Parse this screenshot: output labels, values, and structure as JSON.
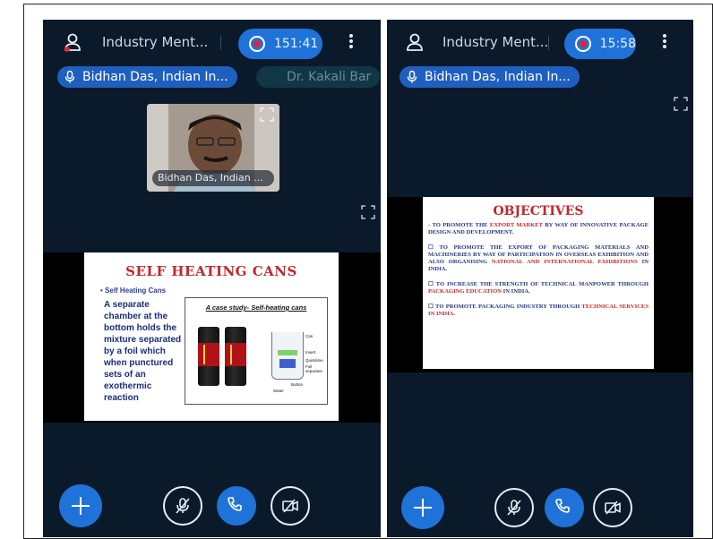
{
  "colors": {
    "panel_bg": "#0b1a2a",
    "accent_blue": "#1f73d8",
    "record_red": "#e0233a",
    "slide_title_red": "#c0282d",
    "slide_text_blue": "#1a2e78"
  },
  "left_phone": {
    "header": {
      "title": "Industry Ment...",
      "timer": "151:41"
    },
    "chips": [
      {
        "label": "Bidhan Das, Indian In..."
      },
      {
        "label": "Dr. Kakali Bar"
      }
    ],
    "video": {
      "name": "Bidhan Das, Indian ..."
    },
    "slide": {
      "title": "SELF HEATING CANS",
      "bullet": "Self Heating Cans",
      "text": "A separate chamber at the bottom holds the mixture separated by a foil which when punctured sets of an exothermic reaction",
      "figure_title": "A case study- Self-heating cans",
      "figure_labels": [
        "Can",
        "Insert",
        "Quicklime",
        "Foil separator",
        "Button",
        "Water"
      ]
    },
    "controls": [
      "add-icon",
      "mic-off-icon",
      "phone-icon",
      "video-off-icon"
    ]
  },
  "right_phone": {
    "header": {
      "title": "Industry Ment...",
      "timer": "15:58"
    },
    "chips": [
      {
        "label": "Bidhan Das, Indian In..."
      }
    ],
    "slide": {
      "title": "OBJECTIVES",
      "item1_pre": "TO PROMOTE THE ",
      "item1_red": "EXPORT MARKET",
      "item1_post": " BY WAY OF INNOVATIVE PACKAGE DESIGN AND DEVELOPMENT.",
      "item2_pre": "TO PROMOTE THE EXPORT OF PACKAGING MATERIALS AND MACHINERIES BY WAY OF PARTICIPATION IN OVERSEAS EXHIBITION AND ALSO ORGANISING ",
      "item2_red": "NATIONAL AND INTERNATIONAL EXHIBITIONS",
      "item2_post": " IN INDIA.",
      "item3_pre": "TO INCREASE THE STRENGTH OF TECHNICAL MANPOWER THROUGH ",
      "item3_red": "PACKAGING EDUCATION",
      "item3_post": " IN INDIA.",
      "item4_pre": "TO PROMOTE PACKAGING INDUSTRY THROUGH ",
      "item4_red": "TECHNICAL SERVICES IN INDIA."
    },
    "controls": [
      "add-icon",
      "mic-off-icon",
      "phone-icon",
      "video-off-icon"
    ]
  }
}
